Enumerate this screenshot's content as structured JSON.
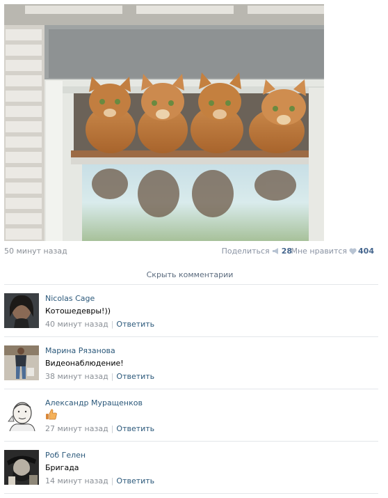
{
  "post": {
    "time": "50 минут назад",
    "share_label": "Поделиться",
    "share_count": "28",
    "like_label": "Мне нравится",
    "like_count": "404",
    "share_icon": "megaphone-icon",
    "like_icon": "heart-icon"
  },
  "hide_comments_label": "Скрыть комментарии",
  "comments": [
    {
      "author": "Nicolas Cage",
      "text": "Котошедевры!))",
      "time": "40 минут назад",
      "reply": "Ответить",
      "separator": "|"
    },
    {
      "author": "Марина Рязанова",
      "text": "Видеонаблюдение!",
      "time": "38 минут назад",
      "reply": "Ответить",
      "separator": "|"
    },
    {
      "author": "Александр Муращенков",
      "text": "",
      "emoji": "thumbs-up-icon",
      "time": "27 минут назад",
      "reply": "Ответить",
      "separator": "|"
    },
    {
      "author": "Роб Гелен",
      "text": "Бригада",
      "time": "14 минут назад",
      "reply": "Ответить",
      "separator": "|"
    }
  ],
  "colors": {
    "link": "#2b587a",
    "muted": "#8a8f96",
    "accent": "#45668e",
    "separator": "#e3e6ea"
  }
}
